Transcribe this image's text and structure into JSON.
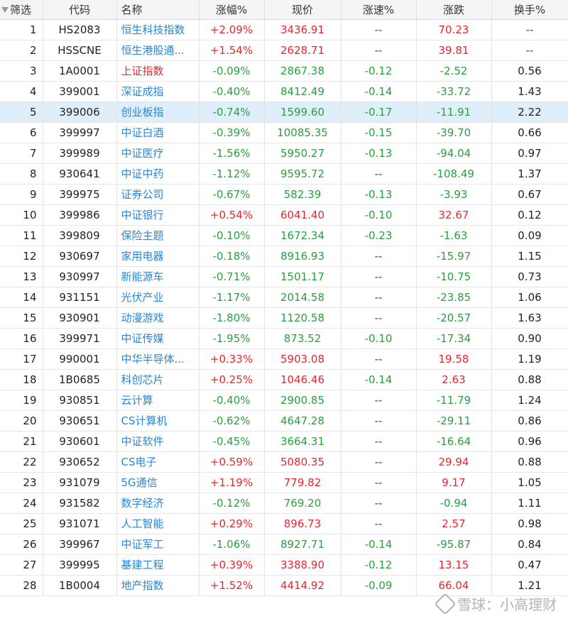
{
  "header": {
    "filter": "筛选",
    "code": "代码",
    "name": "名称",
    "change_pct": "涨幅%",
    "price": "现价",
    "speed_pct": "涨速%",
    "change": "涨跌",
    "turnover_pct": "换手%"
  },
  "rows": [
    {
      "seq": "1",
      "code": "HS2083",
      "name": "恒生科技指数",
      "pct": "+2.09%",
      "price": "3436.91",
      "speed": "--",
      "chg": "70.23",
      "turn": "--",
      "dir": "up",
      "name_color": "blue"
    },
    {
      "seq": "2",
      "code": "HSSCNE",
      "name": "恒生港股通...",
      "pct": "+1.54%",
      "price": "2628.71",
      "speed": "--",
      "chg": "39.81",
      "turn": "--",
      "dir": "up",
      "name_color": "blue"
    },
    {
      "seq": "3",
      "code": "1A0001",
      "name": "上证指数",
      "pct": "-0.09%",
      "price": "2867.38",
      "speed": "-0.12",
      "chg": "-2.52",
      "turn": "0.56",
      "dir": "down",
      "name_color": "red"
    },
    {
      "seq": "4",
      "code": "399001",
      "name": "深证成指",
      "pct": "-0.40%",
      "price": "8412.49",
      "speed": "-0.14",
      "chg": "-33.72",
      "turn": "1.43",
      "dir": "down",
      "name_color": "blue"
    },
    {
      "seq": "5",
      "code": "399006",
      "name": "创业板指",
      "pct": "-0.74%",
      "price": "1599.60",
      "speed": "-0.17",
      "chg": "-11.91",
      "turn": "2.22",
      "dir": "down",
      "name_color": "blue",
      "selected": true
    },
    {
      "seq": "6",
      "code": "399997",
      "name": "中证白酒",
      "pct": "-0.39%",
      "price": "10085.35",
      "speed": "-0.15",
      "chg": "-39.70",
      "turn": "0.66",
      "dir": "down",
      "name_color": "blue"
    },
    {
      "seq": "7",
      "code": "399989",
      "name": "中证医疗",
      "pct": "-1.56%",
      "price": "5950.27",
      "speed": "-0.13",
      "chg": "-94.04",
      "turn": "0.97",
      "dir": "down",
      "name_color": "blue"
    },
    {
      "seq": "8",
      "code": "930641",
      "name": "中证中药",
      "pct": "-1.12%",
      "price": "9595.72",
      "speed": "--",
      "chg": "-108.49",
      "turn": "1.37",
      "dir": "down",
      "name_color": "blue"
    },
    {
      "seq": "9",
      "code": "399975",
      "name": "证券公司",
      "pct": "-0.67%",
      "price": "582.39",
      "speed": "-0.13",
      "chg": "-3.93",
      "turn": "0.67",
      "dir": "down",
      "name_color": "blue"
    },
    {
      "seq": "10",
      "code": "399986",
      "name": "中证银行",
      "pct": "+0.54%",
      "price": "6041.40",
      "speed": "-0.10",
      "chg": "32.67",
      "turn": "0.12",
      "dir": "up",
      "name_color": "blue"
    },
    {
      "seq": "11",
      "code": "399809",
      "name": "保险主题",
      "pct": "-0.10%",
      "price": "1672.34",
      "speed": "-0.23",
      "chg": "-1.63",
      "turn": "0.09",
      "dir": "down",
      "name_color": "blue"
    },
    {
      "seq": "12",
      "code": "930697",
      "name": "家用电器",
      "pct": "-0.18%",
      "price": "8916.93",
      "speed": "--",
      "chg": "-15.97",
      "turn": "1.15",
      "dir": "down",
      "name_color": "blue"
    },
    {
      "seq": "13",
      "code": "930997",
      "name": "新能源车",
      "pct": "-0.71%",
      "price": "1501.17",
      "speed": "--",
      "chg": "-10.75",
      "turn": "0.73",
      "dir": "down",
      "name_color": "blue"
    },
    {
      "seq": "14",
      "code": "931151",
      "name": "光伏产业",
      "pct": "-1.17%",
      "price": "2014.58",
      "speed": "--",
      "chg": "-23.85",
      "turn": "1.06",
      "dir": "down",
      "name_color": "blue"
    },
    {
      "seq": "15",
      "code": "930901",
      "name": "动漫游戏",
      "pct": "-1.80%",
      "price": "1120.58",
      "speed": "--",
      "chg": "-20.57",
      "turn": "1.63",
      "dir": "down",
      "name_color": "blue"
    },
    {
      "seq": "16",
      "code": "399971",
      "name": "中证传媒",
      "pct": "-1.95%",
      "price": "873.52",
      "speed": "-0.10",
      "chg": "-17.34",
      "turn": "0.90",
      "dir": "down",
      "name_color": "blue"
    },
    {
      "seq": "17",
      "code": "990001",
      "name": "中华半导体...",
      "pct": "+0.33%",
      "price": "5903.08",
      "speed": "--",
      "chg": "19.58",
      "turn": "1.19",
      "dir": "up",
      "name_color": "blue"
    },
    {
      "seq": "18",
      "code": "1B0685",
      "name": "科创芯片",
      "pct": "+0.25%",
      "price": "1046.46",
      "speed": "-0.14",
      "chg": "2.63",
      "turn": "0.88",
      "dir": "up",
      "name_color": "blue"
    },
    {
      "seq": "19",
      "code": "930851",
      "name": "云计算",
      "pct": "-0.40%",
      "price": "2900.85",
      "speed": "--",
      "chg": "-11.79",
      "turn": "1.24",
      "dir": "down",
      "name_color": "blue"
    },
    {
      "seq": "20",
      "code": "930651",
      "name": "CS计算机",
      "pct": "-0.62%",
      "price": "4647.28",
      "speed": "--",
      "chg": "-29.11",
      "turn": "0.86",
      "dir": "down",
      "name_color": "blue"
    },
    {
      "seq": "21",
      "code": "930601",
      "name": "中证软件",
      "pct": "-0.45%",
      "price": "3664.31",
      "speed": "--",
      "chg": "-16.64",
      "turn": "0.96",
      "dir": "down",
      "name_color": "blue"
    },
    {
      "seq": "22",
      "code": "930652",
      "name": "CS电子",
      "pct": "+0.59%",
      "price": "5080.35",
      "speed": "--",
      "chg": "29.94",
      "turn": "0.88",
      "dir": "up",
      "name_color": "blue"
    },
    {
      "seq": "23",
      "code": "931079",
      "name": "5G通信",
      "pct": "+1.19%",
      "price": "779.82",
      "speed": "--",
      "chg": "9.17",
      "turn": "1.05",
      "dir": "up",
      "name_color": "blue"
    },
    {
      "seq": "24",
      "code": "931582",
      "name": "数字经济",
      "pct": "-0.12%",
      "price": "769.20",
      "speed": "--",
      "chg": "-0.94",
      "turn": "1.11",
      "dir": "down",
      "name_color": "blue"
    },
    {
      "seq": "25",
      "code": "931071",
      "name": "人工智能",
      "pct": "+0.29%",
      "price": "896.73",
      "speed": "--",
      "chg": "2.57",
      "turn": "0.98",
      "dir": "up",
      "name_color": "blue"
    },
    {
      "seq": "26",
      "code": "399967",
      "name": "中证军工",
      "pct": "-1.06%",
      "price": "8927.71",
      "speed": "-0.14",
      "chg": "-95.87",
      "turn": "0.84",
      "dir": "down",
      "name_color": "blue"
    },
    {
      "seq": "27",
      "code": "399995",
      "name": "基建工程",
      "pct": "+0.39%",
      "price": "3388.90",
      "speed": "-0.12",
      "chg": "13.15",
      "turn": "0.47",
      "dir": "up",
      "name_color": "blue"
    },
    {
      "seq": "28",
      "code": "1B0004",
      "name": "地产指数",
      "pct": "+1.52%",
      "price": "4414.92",
      "speed": "-0.09",
      "chg": "66.04",
      "turn": "1.21",
      "dir": "up",
      "name_color": "blue"
    }
  ],
  "colors": {
    "up": "#e8262d",
    "down": "#28a03c",
    "name_blue": "#2a86d6",
    "selected_row": "#dfeefb"
  },
  "icons": {
    "filter": "sort-down-triangle-icon",
    "watermark": "xueqiu-logo-icon"
  },
  "watermark": {
    "text": "雪球：小高理财"
  }
}
